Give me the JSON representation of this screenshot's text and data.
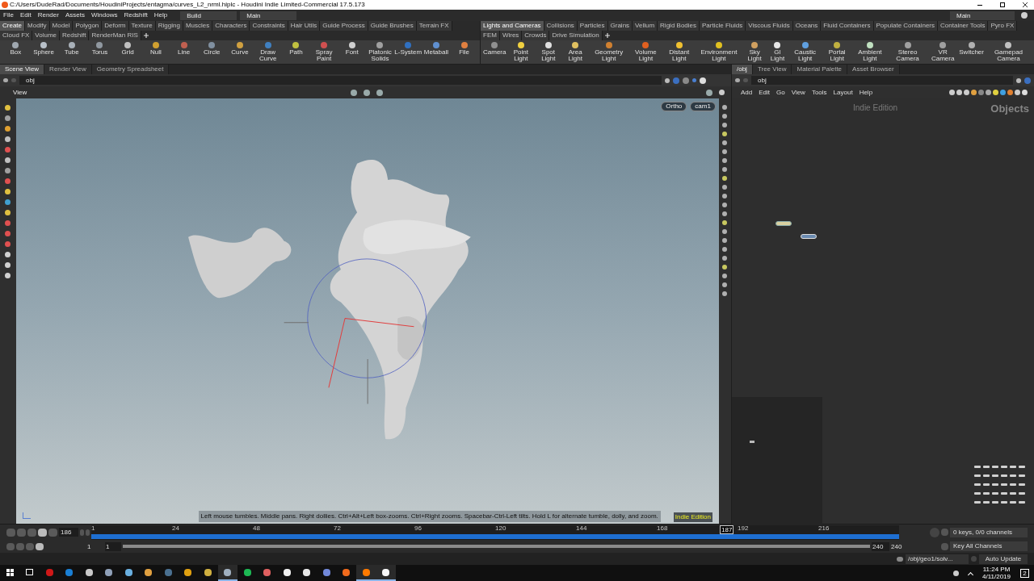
{
  "window": {
    "title": "C:/Users/DudeRad/Documents/HoudiniProjects/entagma/curves_L2_nrml.hiplc - Houdini Indie Limited-Commercial 17.5.173"
  },
  "menu": [
    "File",
    "Edit",
    "Render",
    "Assets",
    "Windows",
    "Redshift",
    "Help"
  ],
  "desk_menu": {
    "value": "Build"
  },
  "viewer_menu": {
    "value": "Main"
  },
  "right_desk_menu": {
    "value": "Main"
  },
  "shelves": [
    {
      "tabs": [
        {
          "label": "Create",
          "selected": true
        },
        {
          "label": "Modify",
          "selected": false
        },
        {
          "label": "Model",
          "selected": false
        },
        {
          "label": "Polygon",
          "selected": false
        },
        {
          "label": "Deform",
          "selected": false
        },
        {
          "label": "Texture",
          "selected": false
        },
        {
          "label": "Rigging",
          "selected": false
        },
        {
          "label": "Muscles",
          "selected": false
        },
        {
          "label": "Characters",
          "selected": false
        },
        {
          "label": "Constraints",
          "selected": false
        },
        {
          "label": "Hair Utils",
          "selected": false
        },
        {
          "label": "Guide Process",
          "selected": false
        },
        {
          "label": "Guide Brushes",
          "selected": false
        },
        {
          "label": "Terrain FX",
          "selected": false
        },
        {
          "label": "Cloud FX",
          "selected": false
        },
        {
          "label": "Volume",
          "selected": false
        },
        {
          "label": "Redshift",
          "selected": false
        },
        {
          "label": "RenderMan RIS",
          "selected": false
        }
      ],
      "tools": [
        {
          "label": "Box",
          "color": "#a0a8b0"
        },
        {
          "label": "Sphere",
          "color": "#b8c0c8"
        },
        {
          "label": "Tube",
          "color": "#a8b0b8"
        },
        {
          "label": "Torus",
          "color": "#9098a0"
        },
        {
          "label": "Grid",
          "color": "#c0c0c0"
        },
        {
          "label": "Null",
          "color": "#d0a030"
        },
        {
          "label": "Line",
          "color": "#c06050"
        },
        {
          "label": "Circle",
          "color": "#8090a0"
        },
        {
          "label": "Curve",
          "color": "#d0a040"
        },
        {
          "label": "Draw Curve",
          "color": "#4080c0"
        },
        {
          "label": "Path",
          "color": "#c0c040"
        },
        {
          "label": "Spray Paint",
          "color": "#d05050"
        },
        {
          "label": "Font",
          "color": "#d0d0d0"
        },
        {
          "label": "Platonic Solids",
          "color": "#a0a0a0"
        },
        {
          "label": "L-System",
          "color": "#3070c0"
        },
        {
          "label": "Metaball",
          "color": "#6090d0"
        },
        {
          "label": "File",
          "color": "#e08040"
        }
      ]
    },
    {
      "tabs": [
        {
          "label": "Lights and Cameras",
          "selected": true
        },
        {
          "label": "Collisions",
          "selected": false
        },
        {
          "label": "Particles",
          "selected": false
        },
        {
          "label": "Grains",
          "selected": false
        },
        {
          "label": "Vellum",
          "selected": false
        },
        {
          "label": "Rigid Bodies",
          "selected": false
        },
        {
          "label": "Particle Fluids",
          "selected": false
        },
        {
          "label": "Viscous Fluids",
          "selected": false
        },
        {
          "label": "Oceans",
          "selected": false
        },
        {
          "label": "Fluid Containers",
          "selected": false
        },
        {
          "label": "Populate Containers",
          "selected": false
        },
        {
          "label": "Container Tools",
          "selected": false
        },
        {
          "label": "Pyro FX",
          "selected": false
        },
        {
          "label": "FEM",
          "selected": false
        },
        {
          "label": "Wires",
          "selected": false
        },
        {
          "label": "Crowds",
          "selected": false
        },
        {
          "label": "Drive Simulation",
          "selected": false
        }
      ],
      "tools": [
        {
          "label": "Camera",
          "color": "#909090"
        },
        {
          "label": "Point Light",
          "color": "#f0d040"
        },
        {
          "label": "Spot Light",
          "color": "#e0e0e0"
        },
        {
          "label": "Area Light",
          "color": "#e0c060"
        },
        {
          "label": "Geometry Light",
          "color": "#d08030"
        },
        {
          "label": "Volume Light",
          "color": "#e06020"
        },
        {
          "label": "Distant Light",
          "color": "#f0c030"
        },
        {
          "label": "Environment Light",
          "color": "#e0c020"
        },
        {
          "label": "Sky Light",
          "color": "#d0a060"
        },
        {
          "label": "GI Light",
          "color": "#e8e8e8"
        },
        {
          "label": "Caustic Light",
          "color": "#60a0e0"
        },
        {
          "label": "Portal Light",
          "color": "#c0b040"
        },
        {
          "label": "Ambient Light",
          "color": "#c0e0c0"
        },
        {
          "label": "Stereo Camera",
          "color": "#a0a0a0"
        },
        {
          "label": "VR Camera",
          "color": "#a0a0a0"
        },
        {
          "label": "Switcher",
          "color": "#b0b0b0"
        },
        {
          "label": "Gamepad Camera",
          "color": "#c0c0c0"
        }
      ]
    }
  ],
  "left_pane": {
    "tabs": [
      {
        "label": "Scene View",
        "selected": true
      },
      {
        "label": "Render View",
        "selected": false
      },
      {
        "label": "Geometry Spreadsheet",
        "selected": false
      }
    ],
    "path": "obj",
    "toolbar_label": "View",
    "viewport": {
      "camera_buttons": [
        "Ortho",
        "cam1"
      ],
      "hint": "Left mouse tumbles. Middle pans. Right dollies. Ctrl+Alt+Left box-zooms. Ctrl+Right zooms. Spacebar-Ctrl-Left tilts. Hold L for alternate tumble, dolly, and zoom.",
      "edition": "Indie Edition"
    }
  },
  "right_pane": {
    "tabs": [
      {
        "label": "/obj",
        "selected": true
      },
      {
        "label": "Tree View",
        "selected": false
      },
      {
        "label": "Material Palette",
        "selected": false
      },
      {
        "label": "Asset Browser",
        "selected": false
      }
    ],
    "path": "obj",
    "menu": [
      "Add",
      "Edit",
      "Go",
      "View",
      "Tools",
      "Layout",
      "Help"
    ],
    "edition": "Indie Edition",
    "context": "Objects"
  },
  "timeline": {
    "frame": "186",
    "ticks": [
      "1",
      "24",
      "48",
      "72",
      "96",
      "120",
      "144",
      "168",
      "192",
      "216"
    ],
    "playhead": {
      "label": "187",
      "level": 0.778
    },
    "start": "1",
    "range_start": "1",
    "range": {
      "level": 1
    },
    "range_end": "240",
    "end": "240",
    "keys": "0 keys, 0/0 channels",
    "key_mode": "Key All Channels"
  },
  "status": {
    "path": "/obj/geo1/solv...",
    "update": "Auto Update"
  },
  "taskbar": {
    "apps": [
      {
        "kind": "start",
        "selected": false
      },
      {
        "kind": "taskview",
        "selected": false
      },
      {
        "kind": "app",
        "color": "#d01818",
        "selected": false
      },
      {
        "kind": "app",
        "color": "#1a7fd4",
        "selected": false
      },
      {
        "kind": "app",
        "color": "#c8c8c8",
        "selected": false
      },
      {
        "kind": "app",
        "color": "#8fa0b8",
        "selected": false
      },
      {
        "kind": "app",
        "color": "#6ab0e0",
        "selected": false
      },
      {
        "kind": "app",
        "color": "#e0a040",
        "selected": false
      },
      {
        "kind": "app",
        "color": "#4a7090",
        "selected": false
      },
      {
        "kind": "app",
        "color": "#e0a010",
        "selected": false
      },
      {
        "kind": "app",
        "color": "#d0b040",
        "selected": false
      },
      {
        "kind": "app",
        "color": "#a0b0c0",
        "selected": true
      },
      {
        "kind": "app",
        "color": "#1db954",
        "selected": false
      },
      {
        "kind": "app",
        "color": "#e06060",
        "selected": false
      },
      {
        "kind": "app",
        "color": "#f0f0f0",
        "selected": false
      },
      {
        "kind": "app",
        "color": "#e8e8e8",
        "selected": false
      },
      {
        "kind": "app",
        "color": "#7289da",
        "selected": false
      },
      {
        "kind": "app",
        "color": "#f06a1c",
        "selected": false
      },
      {
        "kind": "app",
        "color": "#ff7a00",
        "selected": true
      },
      {
        "kind": "app",
        "color": "#f8f8f8",
        "selected": true
      }
    ],
    "time": "11:24 PM",
    "date": "4/11/2019",
    "notifications": "2"
  }
}
